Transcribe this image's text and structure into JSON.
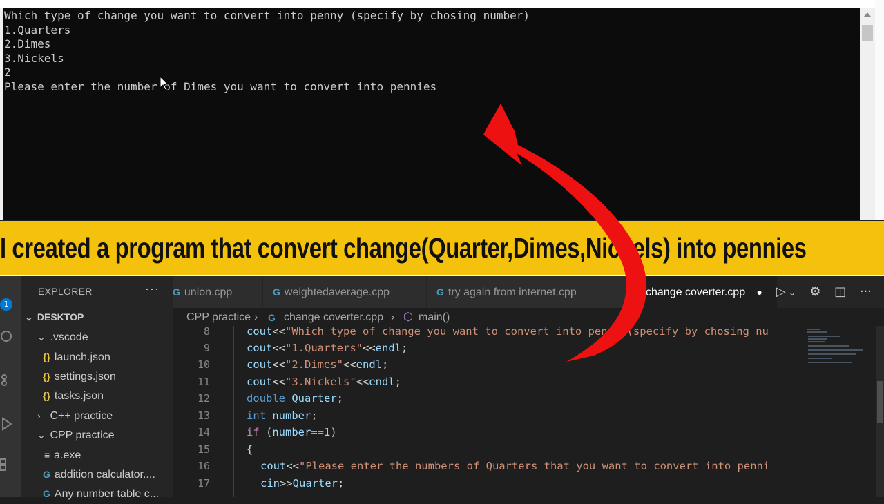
{
  "console": {
    "lines": [
      "Which type of change you want to convert into penny (specify by chosing number)",
      "1.Quarters",
      "2.Dimes",
      "3.Nickels",
      "2",
      "Please enter the number of Dimes you want to convert into pennies"
    ]
  },
  "banner": {
    "text": "I created a program that convert change(Quarter,Dimes,Nickels) into pennies"
  },
  "vscode": {
    "badge": "1",
    "explorer": {
      "header": "EXPLORER",
      "more": "···",
      "items": [
        {
          "label": "DESKTOP"
        },
        {
          "label": ".vscode"
        },
        {
          "label": "launch.json"
        },
        {
          "label": "settings.json"
        },
        {
          "label": "tasks.json"
        },
        {
          "label": "C++ practice"
        },
        {
          "label": "CPP practice"
        },
        {
          "label": "a.exe"
        },
        {
          "label": "addition calculator...."
        },
        {
          "label": "Any number table c..."
        }
      ]
    },
    "tabs": [
      {
        "label": "union.cpp"
      },
      {
        "label": "weightedaverage.cpp"
      },
      {
        "label": "try again from internet.cpp"
      },
      {
        "label": "change coverter.cpp"
      }
    ],
    "breadcrumb": {
      "folder": "CPP practice",
      "file": "change coverter.cpp",
      "symbol": "main()"
    },
    "editor": {
      "line_numbers": [
        "8",
        "9",
        "10",
        "11",
        "12",
        "13",
        "14",
        "15",
        "16",
        "17"
      ],
      "code": [
        "cout<<\"Which type of change you want to convert into penny (specify by chosing nu",
        "cout<<\"1.Quarters\"<<endl;",
        "cout<<\"2.Dimes\"<<endl;",
        "cout<<\"3.Nickels\"<<endl;",
        "double Quarter;",
        "int number;",
        "if (number==1)",
        "{",
        "cout<<\"Please enter the numbers of Quarters that you want to convert into penni",
        "cin>>Quarter;"
      ]
    }
  },
  "colors": {
    "banner_bg": "#f4c20d",
    "arrow": "#ee1111",
    "console_bg": "#0c0c0c",
    "editor_bg": "#1e1e1e"
  },
  "icons": {
    "arrow": "red-curved-arrow-icon",
    "cursor": "mouse-pointer-icon"
  }
}
